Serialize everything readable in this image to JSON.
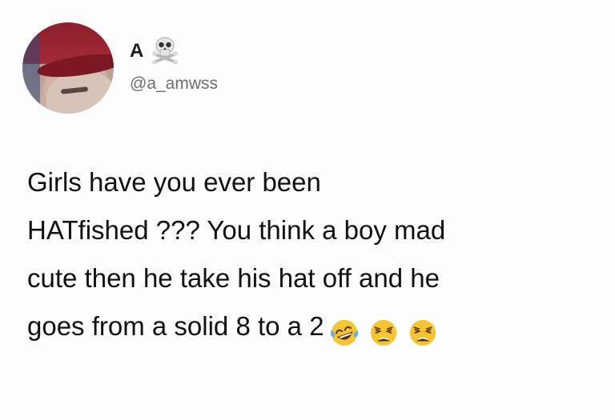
{
  "user": {
    "display_name": "A",
    "name_emoji": "skull-and-crossbones-icon",
    "handle": "@a_amwss"
  },
  "tweet": {
    "lines": [
      "Girls have you ever been",
      "HATfished ??? You think a boy mad",
      "cute then he take his hat off and he",
      "goes from a solid 8 to a 2"
    ],
    "trailing_emojis": [
      "face-with-tears-of-joy-icon",
      "weary-face-icon",
      "weary-face-icon"
    ]
  },
  "colors": {
    "background": "#fdfdfd",
    "text": "#111111",
    "handle": "#6e6e73",
    "emoji_yellow": "#f7c531"
  }
}
